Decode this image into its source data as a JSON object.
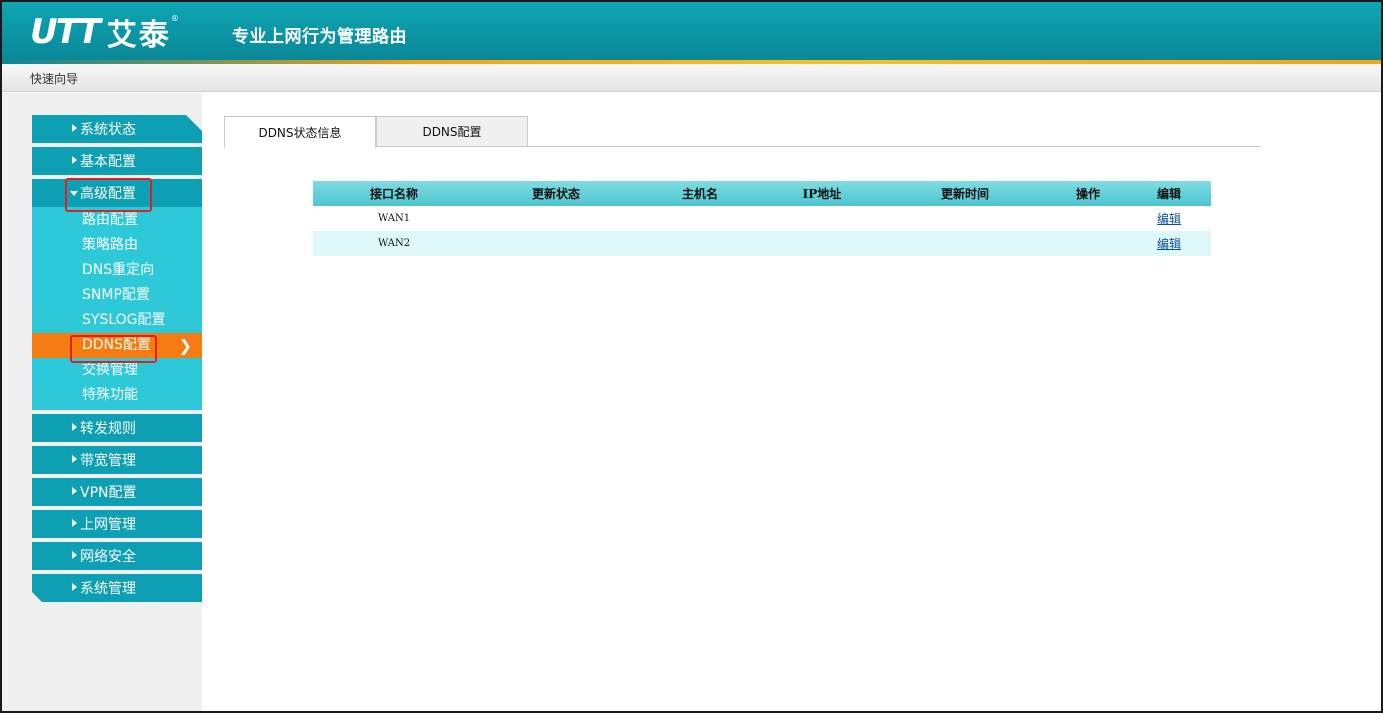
{
  "header": {
    "logo_mark": "UTT",
    "logo_text": "艾泰",
    "logo_reg": "®",
    "slogan": "专业上网行为管理路由"
  },
  "wizard": {
    "label": "快速向导"
  },
  "sidebar": {
    "items": [
      {
        "label": "系统状态"
      },
      {
        "label": "基本配置"
      },
      {
        "label": "高级配置",
        "expanded": true,
        "children": [
          {
            "label": "路由配置"
          },
          {
            "label": "策略路由"
          },
          {
            "label": "DNS重定向"
          },
          {
            "label": "SNMP配置"
          },
          {
            "label": "SYSLOG配置"
          },
          {
            "label": "DDNS配置",
            "active": true
          },
          {
            "label": "交换管理"
          },
          {
            "label": "特殊功能"
          }
        ]
      },
      {
        "label": "转发规则"
      },
      {
        "label": "带宽管理"
      },
      {
        "label": "VPN配置"
      },
      {
        "label": "上网管理"
      },
      {
        "label": "网络安全"
      },
      {
        "label": "系统管理"
      }
    ],
    "active_arrow": "❯"
  },
  "tabs": [
    {
      "label": "DDNS状态信息",
      "active": true
    },
    {
      "label": "DDNS配置",
      "active": false
    }
  ],
  "table": {
    "headers": [
      "接口名称",
      "更新状态",
      "主机名",
      "IP地址",
      "更新时间",
      "操作",
      "编辑"
    ],
    "rows": [
      {
        "interface": "WAN1",
        "status": "",
        "hostname": "",
        "ip": "",
        "time": "",
        "action": "",
        "edit": "编辑"
      },
      {
        "interface": "WAN2",
        "status": "",
        "hostname": "",
        "ip": "",
        "time": "",
        "action": "",
        "edit": "编辑"
      }
    ]
  },
  "colors": {
    "header_teal": "#0b93a2",
    "menu_teal": "#0d9fb3",
    "submenu_cyan": "#2ec9d9",
    "active_orange": "#f57c10",
    "highlight_red": "#e02020"
  }
}
